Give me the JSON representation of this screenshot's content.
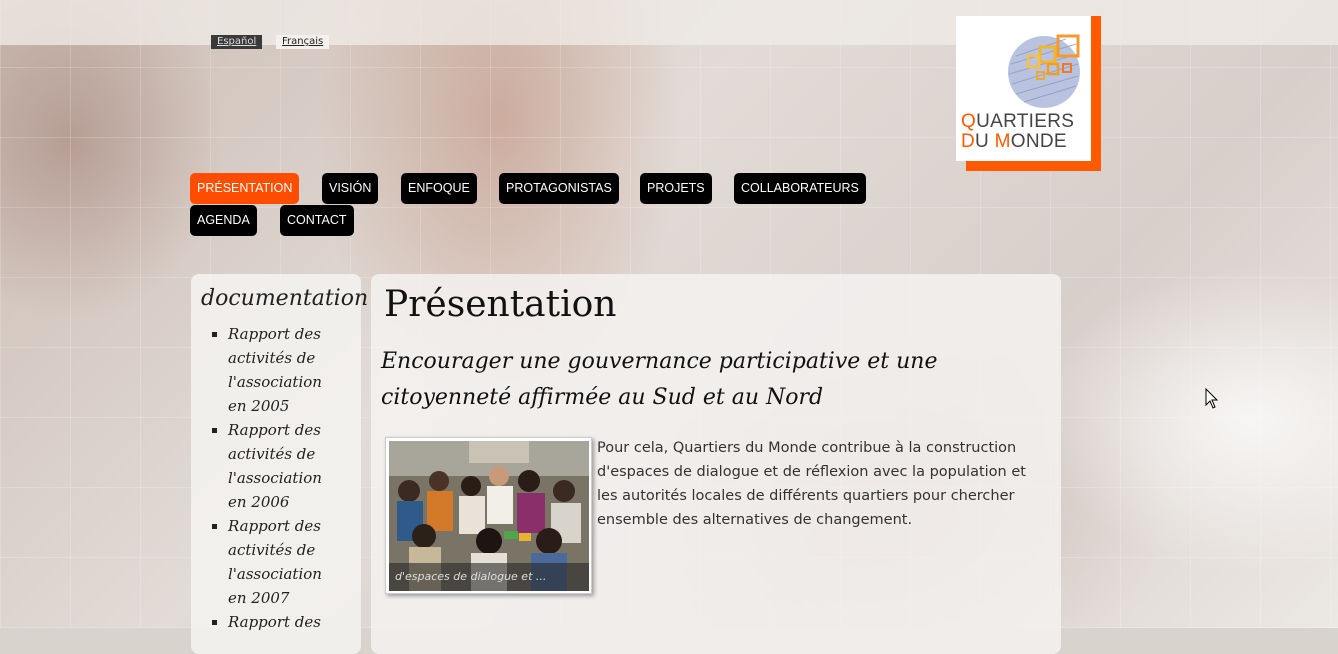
{
  "languages": [
    {
      "label": "Español"
    },
    {
      "label": "Français"
    }
  ],
  "logo": {
    "line1_first": "Q",
    "line1_rest": "UARTIERS",
    "line2_first": "D",
    "line2_mid": "U ",
    "line2_m": "M",
    "line2_rest": "ONDE"
  },
  "nav": [
    {
      "label": "PRÉSENTATION",
      "active": true
    },
    {
      "label": "VISIÓN"
    },
    {
      "label": "ENFOQUE"
    },
    {
      "label": "PROTAGONISTAS"
    },
    {
      "label": "PROJETS"
    },
    {
      "label": "COLLABORATEURS"
    },
    {
      "label": "AGENDA"
    },
    {
      "label": "CONTACT"
    }
  ],
  "sidebar": {
    "title": "documentation",
    "items": [
      {
        "label": "Rapport des activités de l'association en 2005"
      },
      {
        "label": "Rapport des activités de l'association en 2006"
      },
      {
        "label": "Rapport des activités de l'association en 2007"
      },
      {
        "label": "Rapport des"
      }
    ]
  },
  "main": {
    "title": "Présentation",
    "subtitle": "Encourager une gouvernance participative et une citoyenneté affirmée au Sud et au Nord",
    "image_caption": "d'espaces de dialogue et ...",
    "body": "Pour cela, Quartiers du Monde contribue à la construction d'espaces de dialogue et de réflexion avec la population et les autorités locales de différents quartiers pour chercher ensemble des alternatives de changement."
  },
  "colors": {
    "accent": "#ff4d00",
    "nav_bg": "#000000"
  }
}
